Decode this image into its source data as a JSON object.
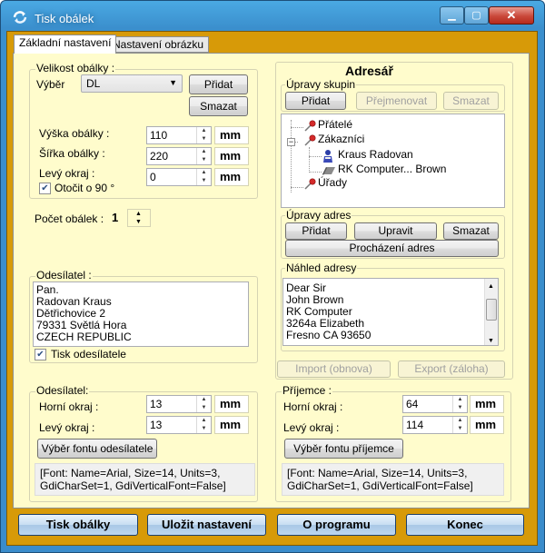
{
  "window": {
    "title": "Tisk obálek",
    "minimize_glyph": "▁",
    "maximize_glyph": "▢",
    "close_glyph": "✕"
  },
  "tabs": [
    {
      "label": "Základní nastavení",
      "active": true
    },
    {
      "label": "Nastavení obrázku",
      "active": false
    }
  ],
  "envelope_size": {
    "group_label": "Velikost obálky :",
    "select_label": "Výběr",
    "select_value": "DL",
    "add_button": "Přidat",
    "delete_button": "Smazat",
    "height_label": "Výška obálky :",
    "height_value": "110",
    "width_label": "Šířka obálky :",
    "width_value": "220",
    "left_margin_label": "Levý okraj :",
    "left_margin_value": "0",
    "unit": "mm",
    "rotate_label": "Otočit o 90 °",
    "rotate_checked": true
  },
  "count": {
    "label": "Počet obálek :",
    "value": "1"
  },
  "sender": {
    "group_label": "Odesílatel :",
    "lines": [
      "Pan.",
      "Radovan  Kraus",
      "Dětřichovice  2",
      "79331  Světlá Hora",
      "CZECH REPUBLIC"
    ],
    "print_label": "Tisk odesílatele",
    "print_checked": true
  },
  "address_book": {
    "title": "Adresář",
    "groups_label": "Úpravy skupin",
    "group_add": "Přidat",
    "group_rename": "Přejmenovat",
    "group_delete": "Smazat",
    "tree": [
      {
        "label": "Přátelé",
        "level": 0,
        "icon": "red-pin-icon"
      },
      {
        "label": "Zákazníci",
        "level": 0,
        "icon": "red-pin-icon",
        "expanded": true
      },
      {
        "label": "Kraus Radovan",
        "level": 1,
        "icon": "person-icon"
      },
      {
        "label": "RK Computer... Brown",
        "level": 1,
        "icon": "company-icon"
      },
      {
        "label": "Úřady",
        "level": 0,
        "icon": "red-pin-icon"
      }
    ],
    "address_edit_label": "Úpravy adres",
    "addr_add": "Přidat",
    "addr_edit": "Upravit",
    "addr_delete": "Smazat",
    "browse": "Procházení adres",
    "preview_label": "Náhled adresy",
    "preview_lines": [
      "Dear Sir",
      "John  Brown",
      "RK Computer",
      "3264a  Elizabeth",
      "Fresno  CA  93650"
    ],
    "import_label": "Import (obnova)",
    "export_label": "Export (záloha)"
  },
  "sender_position": {
    "group_label": "Odesílatel:",
    "top_label": "Horní okraj  :",
    "top_value": "13",
    "left_label": "Levý okraj  :",
    "left_value": "13",
    "unit": "mm",
    "font_button": "Výběr fontu odesílatele",
    "font_info": "[Font: Name=Arial, Size=14, Units=3, GdiCharSet=1, GdiVerticalFont=False]"
  },
  "recipient_position": {
    "group_label": "Příjemce :",
    "top_label": "Horní okraj  :",
    "top_value": "64",
    "left_label": "Levý okraj  :",
    "left_value": "114",
    "unit": "mm",
    "font_button": "Výběr fontu příjemce",
    "font_info": "[Font: Name=Arial, Size=14, Units=3, GdiCharSet=1, GdiVerticalFont=False]"
  },
  "bottom_buttons": {
    "print": "Tisk obálky",
    "save": "Uložit nastavení",
    "about": "O programu",
    "exit": "Konec"
  }
}
